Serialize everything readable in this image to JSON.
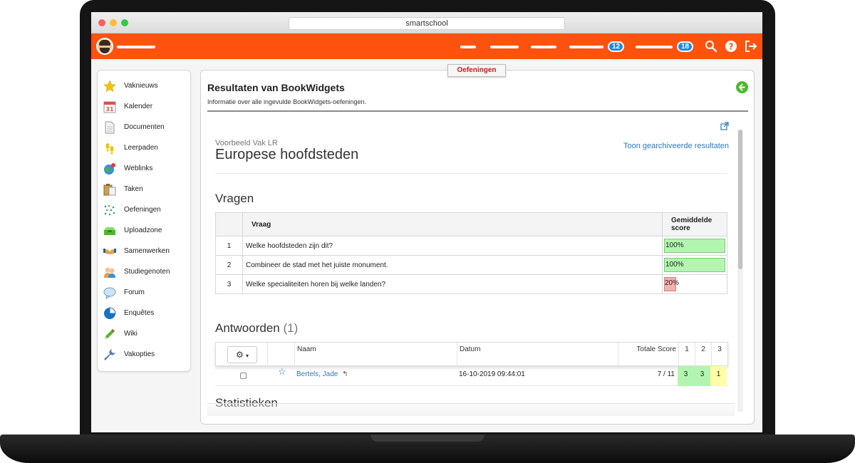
{
  "browser": {
    "url": "smartschool"
  },
  "topnav": {
    "badges": [
      "12",
      "18"
    ]
  },
  "sidebar": {
    "items": [
      {
        "label": "Vaknieuws"
      },
      {
        "label": "Kalender"
      },
      {
        "label": "Documenten"
      },
      {
        "label": "Leerpaden"
      },
      {
        "label": "Weblinks"
      },
      {
        "label": "Taken"
      },
      {
        "label": "Oefeningen"
      },
      {
        "label": "Uploadzone"
      },
      {
        "label": "Samenwerken"
      },
      {
        "label": "Studiegenoten"
      },
      {
        "label": "Forum"
      },
      {
        "label": "Enquêtes"
      },
      {
        "label": "Wiki"
      },
      {
        "label": "Vakopties"
      }
    ],
    "calendar_day": "31"
  },
  "tab": {
    "label": "Oefeningen"
  },
  "main": {
    "title": "Resultaten van BookWidgets",
    "subtitle": "Informatie over alle ingevulde BookWidgets-oefeningen."
  },
  "widget": {
    "course": "Voorbeeld Vak LR",
    "title": "Europese hoofdsteden",
    "archived_link": "Toon gearchiveerde resultaten",
    "questions_heading": "Vragen",
    "questions_table": {
      "headers": [
        "",
        "Vraag",
        "Gemiddelde score"
      ],
      "rows": [
        {
          "num": "1",
          "question": "Welke hoofdsteden zijn dit?",
          "score": "100%",
          "score_fraction": 1.0
        },
        {
          "num": "2",
          "question": "Combineer de stad met het juiste monument.",
          "score": "100%",
          "score_fraction": 1.0
        },
        {
          "num": "3",
          "question": "Welke specialiteiten horen bij welke landen?",
          "score": "20%",
          "score_fraction": 0.2
        }
      ]
    },
    "answers_heading": "Antwoorden",
    "answers_count": "(1)",
    "answers_table": {
      "headers": {
        "name": "Naam",
        "date": "Datum",
        "total": "Totale Score",
        "q1": "1",
        "q2": "2",
        "q3": "3"
      },
      "rows": [
        {
          "name": "Bertels, Jade",
          "reply_icon": "↰",
          "date": "16-10-2019 09:44:01",
          "total": "7 / 11",
          "q1": "3",
          "q2": "3",
          "q3": "1"
        }
      ]
    },
    "statistics_heading": "Statistieken"
  },
  "colors": {
    "brand_orange": "#ff520e",
    "badge_blue": "#1a8ce8",
    "link_blue": "#2a7ac0",
    "score_green": "#b3f5b0",
    "score_red": "#f5b0b0",
    "score_yellow": "#fffda8"
  }
}
